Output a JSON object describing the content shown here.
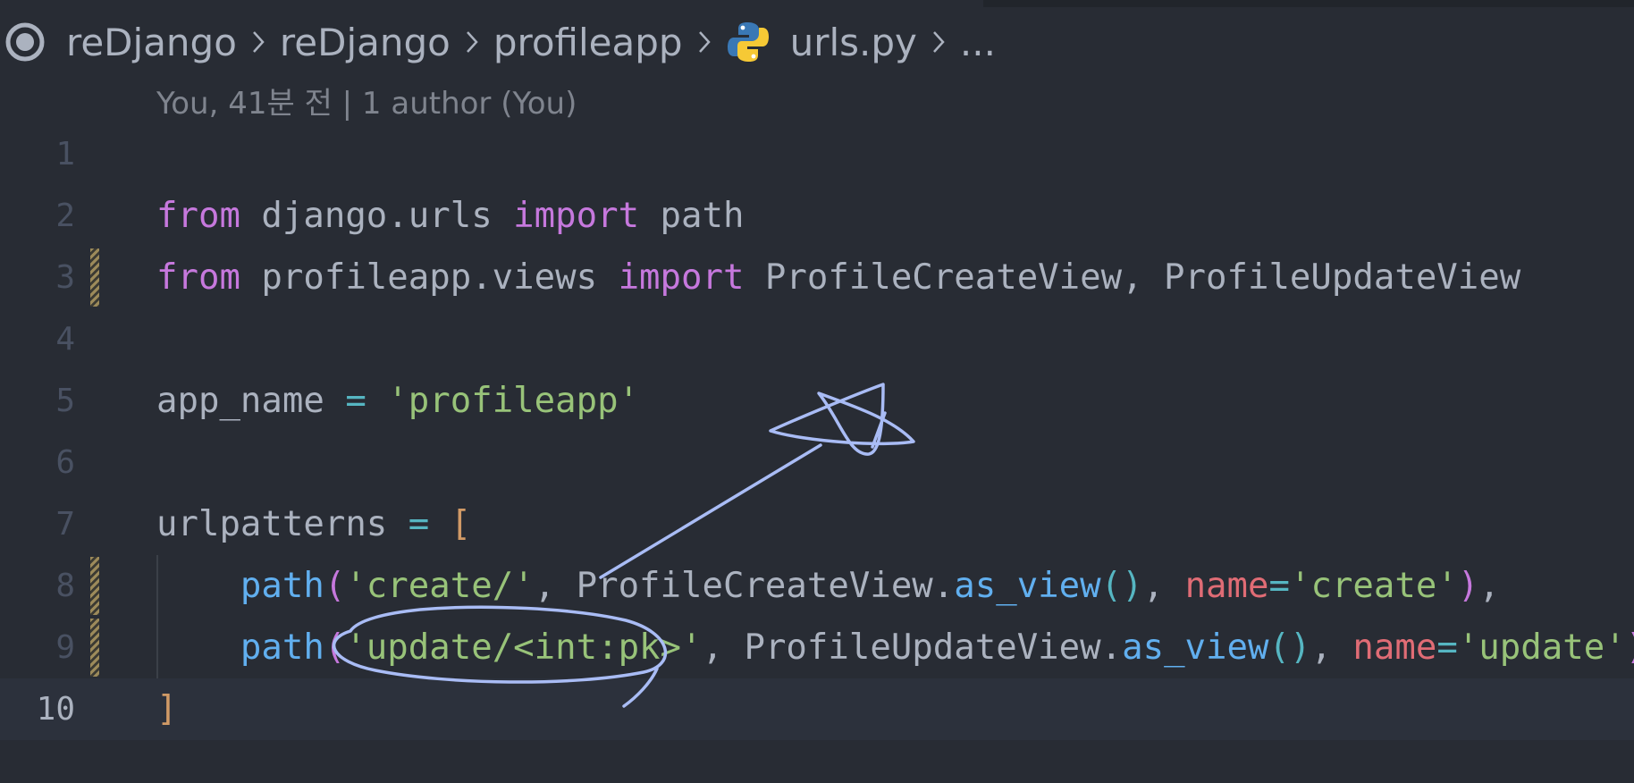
{
  "breadcrumb": {
    "segments": [
      "reDjango",
      "reDjango",
      "profileapp",
      "urls.py",
      "..."
    ]
  },
  "blame": "You, 41분 전 | 1 author (You)",
  "lines": {
    "l1": {
      "num": "1"
    },
    "l2": {
      "num": "2",
      "t1": "from",
      "t2": " django.urls ",
      "t3": "import",
      "t4": " path"
    },
    "l3": {
      "num": "3",
      "t1": "from",
      "t2": " profileapp.views ",
      "t3": "import",
      "t4": " ProfileCreateView, ProfileUpdateView"
    },
    "l4": {
      "num": "4"
    },
    "l5": {
      "num": "5",
      "t1": "app_name ",
      "t2": "=",
      "t3": " ",
      "t4": "'profileapp'"
    },
    "l6": {
      "num": "6"
    },
    "l7": {
      "num": "7",
      "t1": "urlpatterns ",
      "t2": "=",
      "t3": " ",
      "t4": "["
    },
    "l8": {
      "num": "8",
      "indent": "    ",
      "t1": "path",
      "t2": "(",
      "t3": "'create/'",
      "t4": ", ProfileCreateView.",
      "t5": "as_view",
      "t6": "()",
      "t7": ", ",
      "t8": "name",
      "t9": "=",
      "t10": "'create'",
      "t11": ")",
      "t12": ","
    },
    "l9": {
      "num": "9",
      "indent": "    ",
      "t1": "path",
      "t2": "(",
      "t3": "'update/<int:pk>'",
      "t4": ", ProfileUpdateView.",
      "t5": "as_view",
      "t6": "()",
      "t7": ", ",
      "t8": "name",
      "t9": "=",
      "t10": "'update'",
      "t11": ")",
      "t12": ","
    },
    "l10": {
      "num": "10",
      "t1": "]"
    }
  },
  "colors": {
    "background": "#282c34",
    "keyword": "#c678dd",
    "function": "#61afef",
    "string": "#98c379",
    "operator": "#56b6c2",
    "parameter": "#e06c75",
    "bracket": "#d19a66",
    "annotation": "#a9bcf5"
  },
  "icons": [
    "outline-circle-icon",
    "chevron-right-icon",
    "python-file-icon"
  ]
}
